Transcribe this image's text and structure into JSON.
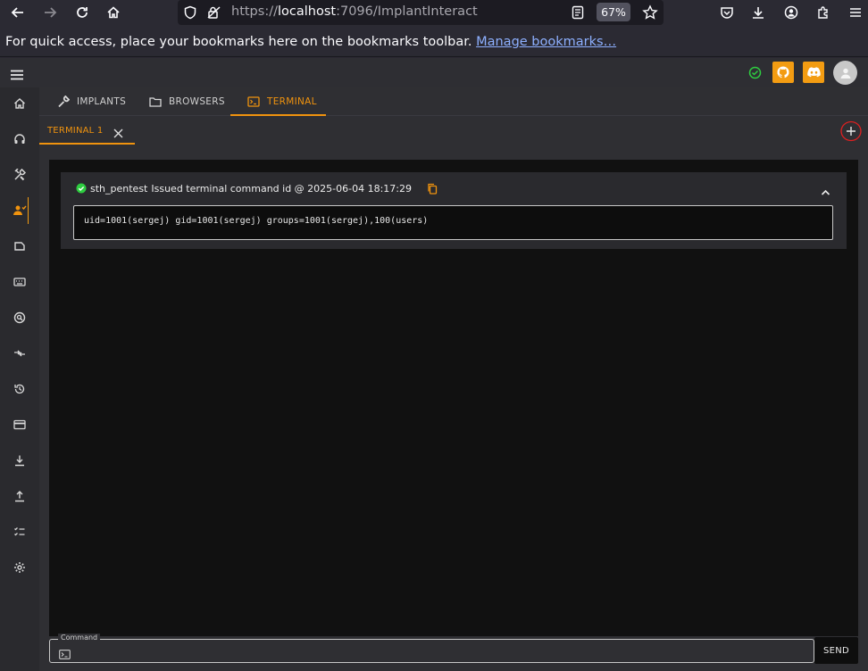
{
  "browser": {
    "url_prefix": "https://",
    "url_host": "localhost",
    "url_rest": ":7096/ImplantInteract",
    "zoom": "67%"
  },
  "bookmarks": {
    "text": "For quick access, place your bookmarks here on the bookmarks toolbar.",
    "link": "Manage bookmarks…"
  },
  "tabs": [
    {
      "label": "IMPLANTS",
      "icon": "wrench-icon"
    },
    {
      "label": "BROWSERS",
      "icon": "folder-icon"
    },
    {
      "label": "TERMINAL",
      "icon": "terminal-icon"
    }
  ],
  "terminal_tab": {
    "label": "TERMINAL 1"
  },
  "command_entry": {
    "user": "sth_pentest",
    "text": "Issued terminal command id @ 2025-06-04 18:17:29",
    "output": "uid=1001(sergej) gid=1001(sergej) groups=1001(sergej),100(users)"
  },
  "command_input": {
    "label": "Command",
    "value": ""
  },
  "send_label": "SEND",
  "colors": {
    "accent": "#f0930e",
    "success": "#2ecc40",
    "github": "#f39c12",
    "discord": "#f39c12"
  },
  "sidebar": [
    "home-icon",
    "headset-icon",
    "tools-icon",
    "users-icon",
    "file-icon",
    "keyboard-icon",
    "search-settings-icon",
    "swap-icon",
    "history-icon",
    "card-icon",
    "download-icon",
    "upload-icon",
    "checklist-icon",
    "gear-icon"
  ]
}
